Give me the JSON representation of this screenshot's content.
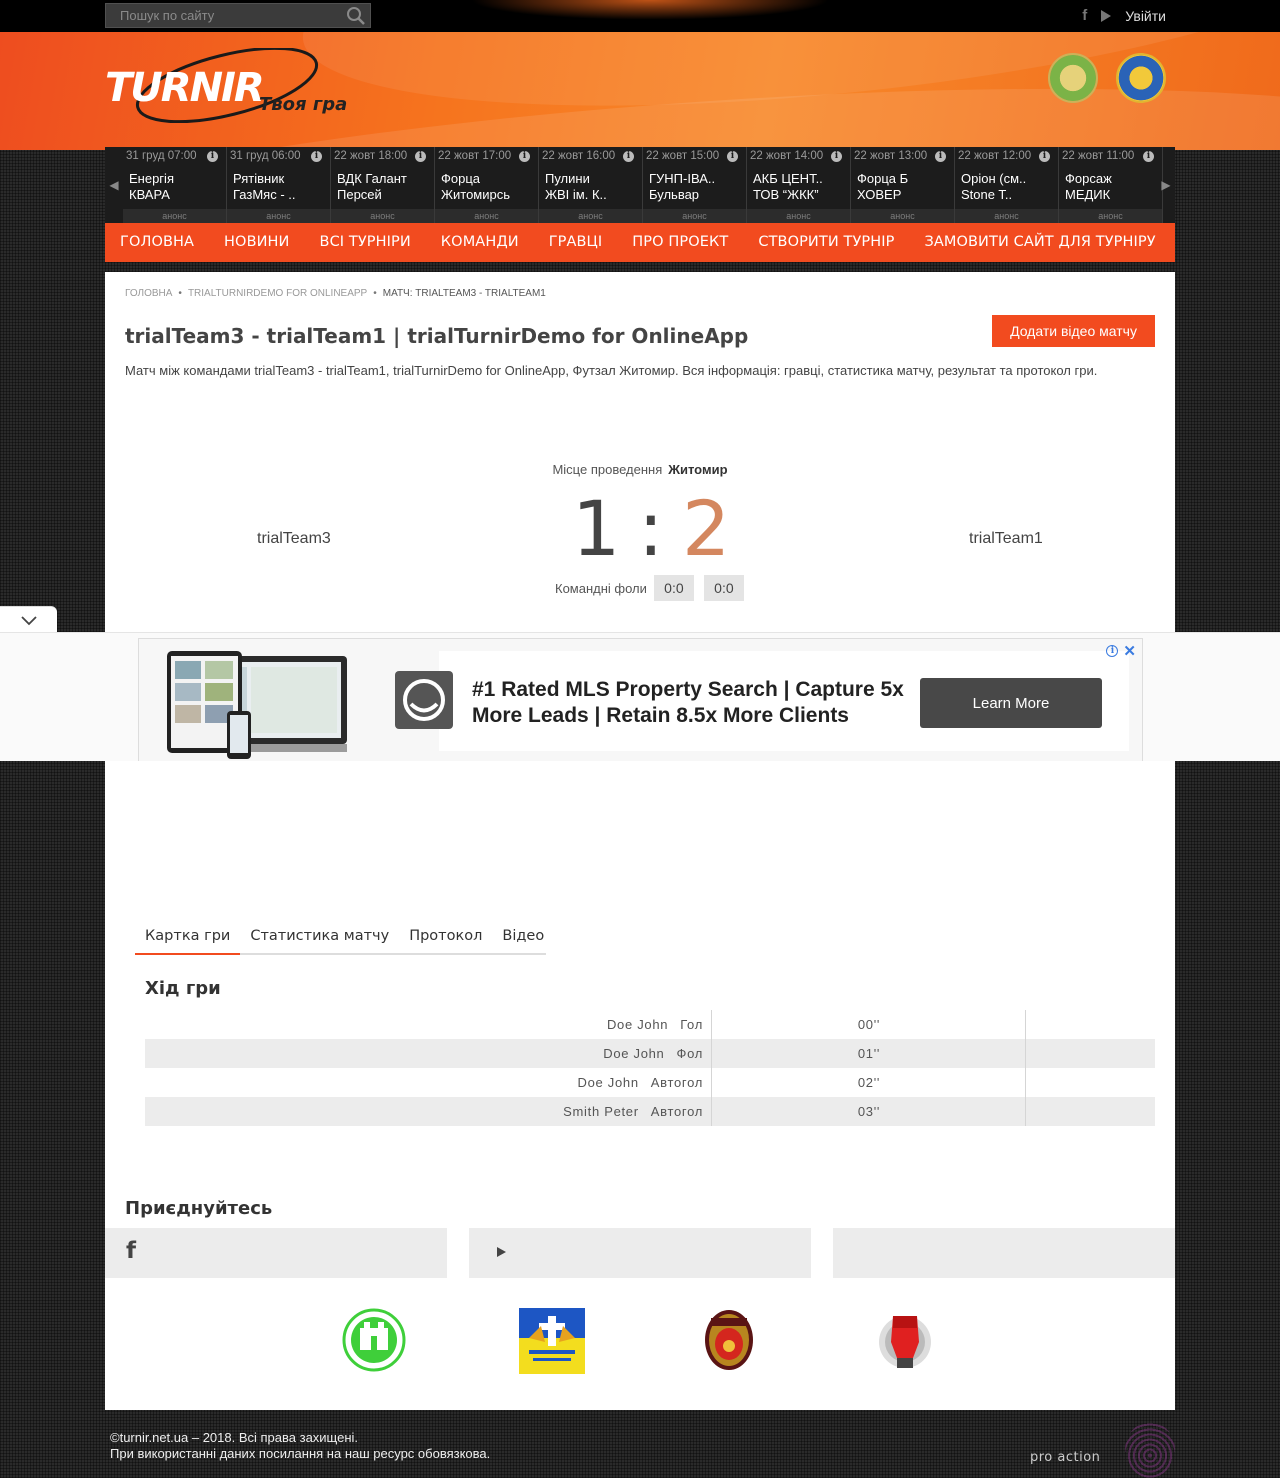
{
  "topbar": {
    "search_placeholder": "Пошук по сайту",
    "login": "Увійти"
  },
  "header": {
    "logo_text": "TURNIR",
    "tagline": "Твоя гра"
  },
  "ticker": [
    {
      "date": "31 груд 07:00",
      "team1": "Енергія",
      "team2": "КВАРА",
      "status": "анонс"
    },
    {
      "date": "31 груд 06:00",
      "team1": "Рятівник",
      "team2": "ГазМяс - ..",
      "status": "анонс"
    },
    {
      "date": "22 жовт 18:00",
      "team1": "ВДК Галант",
      "team2": "Персей",
      "status": "анонс"
    },
    {
      "date": "22 жовт 17:00",
      "team1": "Форца",
      "team2": "Житомирсь",
      "status": "анонс"
    },
    {
      "date": "22 жовт 16:00",
      "team1": "Пулини",
      "team2": "ЖВІ ім. К..",
      "status": "анонс"
    },
    {
      "date": "22 жовт 15:00",
      "team1": "ГУНП-ІВА..",
      "team2": "Бульвар",
      "status": "анонс"
    },
    {
      "date": "22 жовт 14:00",
      "team1": "АКБ ЦЕНТ..",
      "team2": "ТОВ “ЖКК”",
      "status": "анонс"
    },
    {
      "date": "22 жовт 13:00",
      "team1": "Форца Б",
      "team2": "ХОВЕР",
      "status": "анонс"
    },
    {
      "date": "22 жовт 12:00",
      "team1": "Оріон (см..",
      "team2": "Stone T..",
      "status": "анонс"
    },
    {
      "date": "22 жовт 11:00",
      "team1": "Форсаж",
      "team2": "МЕДИК",
      "status": "анонс"
    }
  ],
  "nav": [
    "ГОЛОВНА",
    "НОВИНИ",
    "ВСІ ТУРНІРИ",
    "КОМАНДИ",
    "ГРАВЦІ",
    "ПРО ПРОЕКТ",
    "СТВОРИТИ ТУРНІР",
    "ЗАМОВИТИ САЙТ ДЛЯ ТУРНІРУ"
  ],
  "breadcrumb": {
    "home": "Головна",
    "tournament": "trialTurnirDemo for OnlineApp",
    "current": "Матч: trialTeam3 - trialTeam1"
  },
  "match": {
    "title": "trialTeam3 - trialTeam1 | trialTurnirDemo for OnlineApp",
    "add_video": "Додати відео матчу",
    "description": "Матч між командами trialTeam3 - trialTeam1, trialTurnirDemo for OnlineApp, Футзал Житомир. Вся інформація: гравці, статистика матчу, результат та протокол гри.",
    "venue_label": "Місце проведення",
    "venue": "Житомир",
    "team_home": "trialTeam3",
    "team_away": "trialTeam1",
    "score_home": "1",
    "score_sep": ":",
    "score_away": "2",
    "fouls_label": "Командні фоли",
    "fouls_home": "0:0",
    "fouls_away": "0:0"
  },
  "ad": {
    "headline": "#1 Rated MLS Property Search | Capture 5x More Leads | Retain 8.5x More Clients",
    "cta": "Learn More"
  },
  "tabs": [
    "Картка гри",
    "Статистика матчу",
    "Протокол",
    "Відео"
  ],
  "game_heading": "Хід гри",
  "events": [
    {
      "player": "Doe John",
      "type": "Гол",
      "minute": "00''"
    },
    {
      "player": "Doe John",
      "type": "Фол",
      "minute": "01''"
    },
    {
      "player": "Doe John",
      "type": "Автогол",
      "minute": "02''"
    },
    {
      "player": "Smith Peter",
      "type": "Автогол",
      "minute": "03''"
    }
  ],
  "join_heading": "Приєднуйтесь",
  "footer": {
    "line1": "©turnir.net.ua – 2018. Всі права захищені.",
    "line2": "При використанні даних посилання на наш ресурс обовязкова.",
    "brand": "pro action"
  },
  "colors": {
    "accent": "#f24b1f",
    "score_away": "#d4875f"
  }
}
